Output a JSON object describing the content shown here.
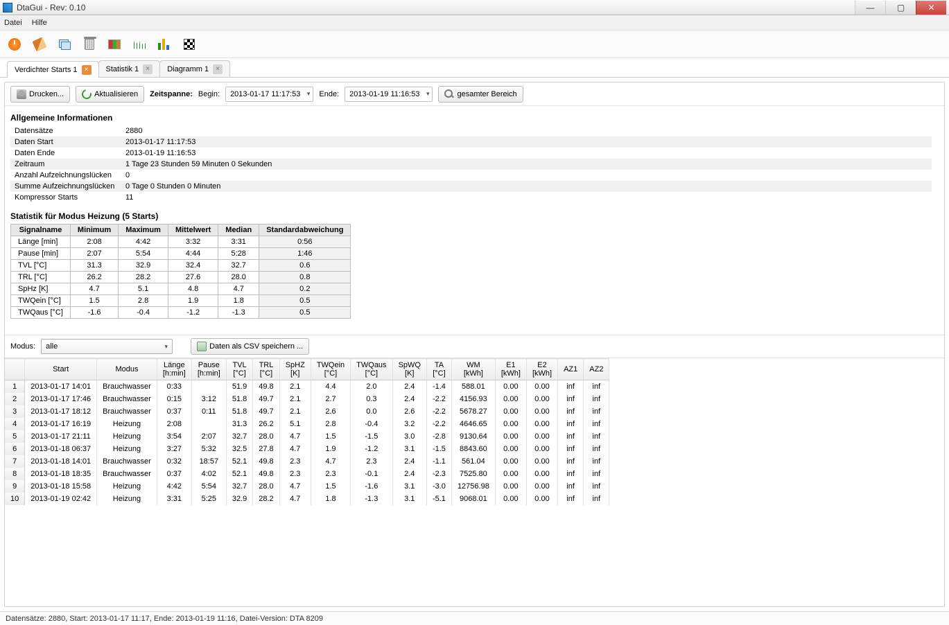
{
  "title": "DtaGui - Rev: 0.10",
  "menu": {
    "file": "Datei",
    "help": "Hilfe"
  },
  "tabs": [
    {
      "label": "Verdichter Starts 1",
      "active": true,
      "orange": true
    },
    {
      "label": "Statistik 1",
      "active": false,
      "orange": false
    },
    {
      "label": "Diagramm 1",
      "active": false,
      "orange": false
    }
  ],
  "controls": {
    "print": "Drucken...",
    "refresh": "Aktualisieren",
    "span_label": "Zeitspanne:",
    "begin_label": "Begin:",
    "begin_value": "2013-01-17 11:17:53",
    "end_label": "Ende:",
    "end_value": "2013-01-19 11:16:53",
    "full_range": "gesamter Bereich"
  },
  "info_header": "Allgemeine Informationen",
  "info": [
    {
      "k": "Datensätze",
      "v": "2880"
    },
    {
      "k": "Daten Start",
      "v": "2013-01-17 11:17:53"
    },
    {
      "k": "Daten Ende",
      "v": "2013-01-19 11:16:53"
    },
    {
      "k": "Zeitraum",
      "v": "1 Tage 23 Stunden 59 Minuten 0 Sekunden"
    },
    {
      "k": "Anzahl Aufzeichnungslücken",
      "v": "0"
    },
    {
      "k": "Summe Aufzeichnungslücken",
      "v": "0 Tage 0 Stunden 0 Minuten"
    },
    {
      "k": "Kompressor Starts",
      "v": "11"
    }
  ],
  "stats_header": "Statistik für Modus Heizung (5 Starts)",
  "stats_cols": [
    "Signalname",
    "Minimum",
    "Maximum",
    "Mittelwert",
    "Median",
    "Standardabweichung"
  ],
  "stats": [
    [
      "Länge [min]",
      "2:08",
      "4:42",
      "3:32",
      "3:31",
      "0:56"
    ],
    [
      "Pause [min]",
      "2:07",
      "5:54",
      "4:44",
      "5:28",
      "1:46"
    ],
    [
      "TVL [°C]",
      "31.3",
      "32.9",
      "32.4",
      "32.7",
      "0.6"
    ],
    [
      "TRL [°C]",
      "26.2",
      "28.2",
      "27.6",
      "28.0",
      "0.8"
    ],
    [
      "SpHz [K]",
      "4.7",
      "5.1",
      "4.8",
      "4.7",
      "0.2"
    ],
    [
      "TWQein [°C]",
      "1.5",
      "2.8",
      "1.9",
      "1.8",
      "0.5"
    ],
    [
      "TWQaus [°C]",
      "-1.6",
      "-0.4",
      "-1.2",
      "-1.3",
      "0.5"
    ]
  ],
  "mode_label": "Modus:",
  "mode_value": "alle",
  "csv_label": "Daten als CSV speichern ...",
  "data_cols": [
    "",
    "Start",
    "Modus",
    "Länge\n[h:min]",
    "Pause\n[h:min]",
    "TVL\n[°C]",
    "TRL\n[°C]",
    "SpHZ\n[K]",
    "TWQein\n[°C]",
    "TWQaus\n[°C]",
    "SpWQ\n[K]",
    "TA\n[°C]",
    "WM\n[kWh]",
    "E1\n[kWh]",
    "E2\n[kWh]",
    "AZ1",
    "AZ2"
  ],
  "data_rows": [
    [
      "1",
      "2013-01-17 14:01",
      "Brauchwasser",
      "0:33",
      "",
      "51.9",
      "49.8",
      "2.1",
      "4.4",
      "2.0",
      "2.4",
      "-1.4",
      "588.01",
      "0.00",
      "0.00",
      "inf",
      "inf"
    ],
    [
      "2",
      "2013-01-17 17:46",
      "Brauchwasser",
      "0:15",
      "3:12",
      "51.8",
      "49.7",
      "2.1",
      "2.7",
      "0.3",
      "2.4",
      "-2.2",
      "4156.93",
      "0.00",
      "0.00",
      "inf",
      "inf"
    ],
    [
      "3",
      "2013-01-17 18:12",
      "Brauchwasser",
      "0:37",
      "0:11",
      "51.8",
      "49.7",
      "2.1",
      "2.6",
      "0.0",
      "2.6",
      "-2.2",
      "5678.27",
      "0.00",
      "0.00",
      "inf",
      "inf"
    ],
    [
      "4",
      "2013-01-17 16:19",
      "Heizung",
      "2:08",
      "",
      "31.3",
      "26.2",
      "5.1",
      "2.8",
      "-0.4",
      "3.2",
      "-2.2",
      "4646.65",
      "0.00",
      "0.00",
      "inf",
      "inf"
    ],
    [
      "5",
      "2013-01-17 21:11",
      "Heizung",
      "3:54",
      "2:07",
      "32.7",
      "28.0",
      "4.7",
      "1.5",
      "-1.5",
      "3.0",
      "-2.8",
      "9130.64",
      "0.00",
      "0.00",
      "inf",
      "inf"
    ],
    [
      "6",
      "2013-01-18 06:37",
      "Heizung",
      "3:27",
      "5:32",
      "32.5",
      "27.8",
      "4.7",
      "1.9",
      "-1.2",
      "3.1",
      "-1.5",
      "8843.60",
      "0.00",
      "0.00",
      "inf",
      "inf"
    ],
    [
      "7",
      "2013-01-18 14:01",
      "Brauchwasser",
      "0:32",
      "18:57",
      "52.1",
      "49.8",
      "2.3",
      "4.7",
      "2.3",
      "2.4",
      "-1.1",
      "561.04",
      "0.00",
      "0.00",
      "inf",
      "inf"
    ],
    [
      "8",
      "2013-01-18 18:35",
      "Brauchwasser",
      "0:37",
      "4:02",
      "52.1",
      "49.8",
      "2.3",
      "2.3",
      "-0.1",
      "2.4",
      "-2.3",
      "7525.80",
      "0.00",
      "0.00",
      "inf",
      "inf"
    ],
    [
      "9",
      "2013-01-18 15:58",
      "Heizung",
      "4:42",
      "5:54",
      "32.7",
      "28.0",
      "4.7",
      "1.5",
      "-1.6",
      "3.1",
      "-3.0",
      "12756.98",
      "0.00",
      "0.00",
      "inf",
      "inf"
    ],
    [
      "10",
      "2013-01-19 02:42",
      "Heizung",
      "3:31",
      "5:25",
      "32.9",
      "28.2",
      "4.7",
      "1.8",
      "-1.3",
      "3.1",
      "-5.1",
      "9068.01",
      "0.00",
      "0.00",
      "inf",
      "inf"
    ]
  ],
  "status": "Datensätze: 2880, Start: 2013-01-17 11:17, Ende: 2013-01-19 11:16, Datei-Version: DTA 8209"
}
